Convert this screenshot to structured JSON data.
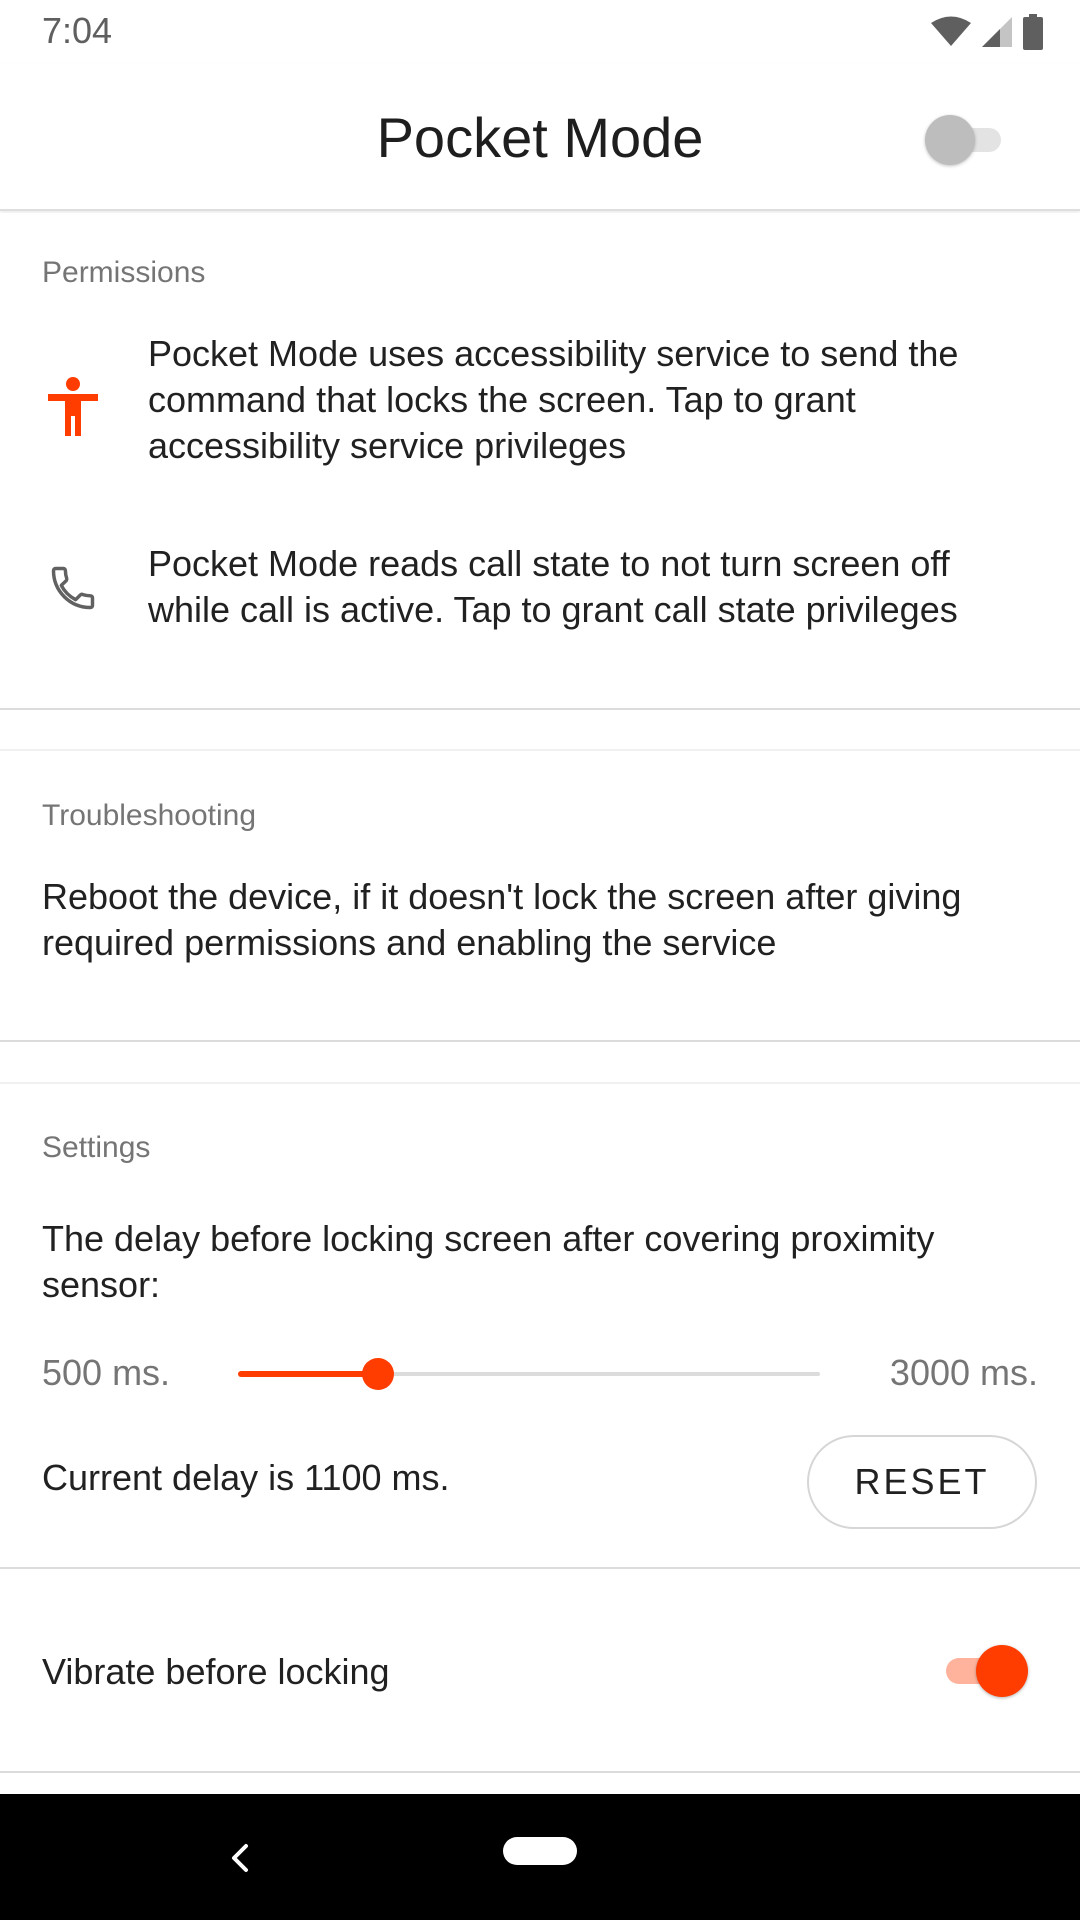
{
  "status_bar": {
    "time": "7:04",
    "icons": [
      "wifi-icon",
      "cellular-signal-icon",
      "battery-icon"
    ]
  },
  "app_bar": {
    "title": "Pocket Mode",
    "service_switch": {
      "on": false
    }
  },
  "permissions": {
    "header": "Permissions",
    "items": [
      {
        "icon": "accessibility-icon",
        "text": "Pocket Mode uses accessibility service to send the command that locks the screen. Tap to grant accessibility service privileges"
      },
      {
        "icon": "phone-icon",
        "text": "Pocket Mode reads call state to not turn screen off while call is active. Tap to grant call state privileges"
      }
    ]
  },
  "troubleshooting": {
    "header": "Troubleshooting",
    "text": "Reboot the device, if it doesn't lock the screen after giving required permissions and enabling the service"
  },
  "settings": {
    "header": "Settings",
    "delay_description": "The delay before locking screen after covering proximity sensor:",
    "slider": {
      "min_label": "500 ms.",
      "max_label": "3000 ms.",
      "min": 500,
      "max": 3000,
      "value": 1100
    },
    "current_delay": "Current delay is 1100 ms.",
    "reset_label": "RESET",
    "vibrate_label": "Vibrate before locking",
    "vibrate_switch": {
      "on": true
    }
  },
  "colors": {
    "accent": "#ff3d00",
    "accent_track": "#ffb39c",
    "secondary_text": "#757575",
    "divider": "#dcdcdc"
  },
  "nav_bar": {
    "icons": [
      "back-icon",
      "home-pill"
    ]
  }
}
